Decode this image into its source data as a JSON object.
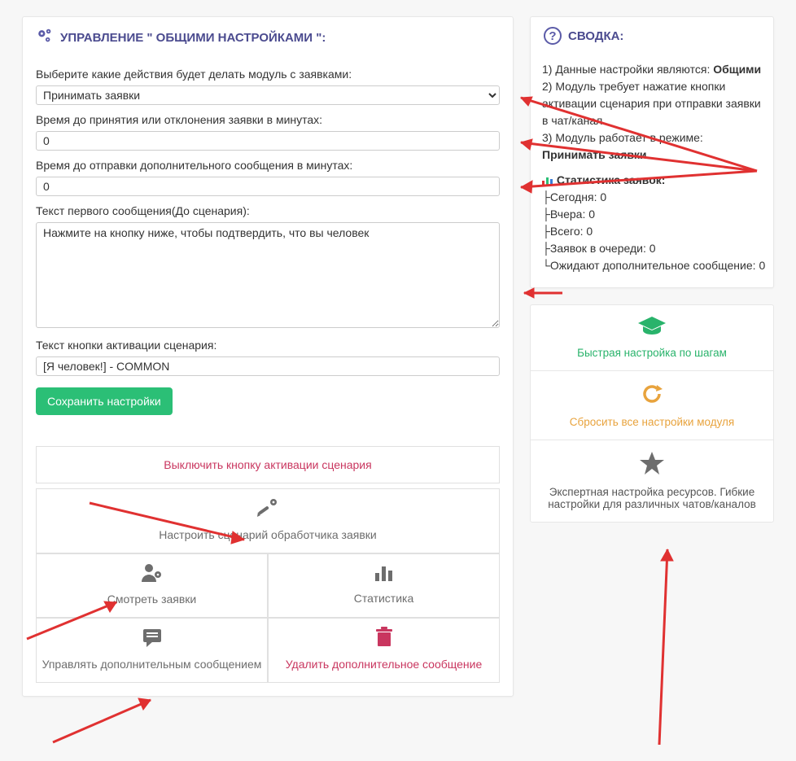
{
  "main": {
    "title": "УПРАВЛЕНИЕ \" ОБЩИМИ НАСТРОЙКАМИ \":",
    "action_label": "Выберите какие действия будет делать модуль с заявками:",
    "action_selected": "Принимать заявки",
    "time_accept_label": "Время до принятия или отклонения заявки в минутах:",
    "time_accept_value": "0",
    "time_extra_label": "Время до отправки дополнительного сообщения в минутах:",
    "time_extra_value": "0",
    "first_msg_label": "Текст первого сообщения(До сценария):",
    "first_msg_value": "Нажмите на кнопку ниже, чтобы подтвердить, что вы человек",
    "button_text_label": "Текст кнопки активации сценария:",
    "button_text_value": "[Я человек!] - COMMON",
    "save_btn": "Сохранить настройки",
    "disable_btn": "Выключить кнопку активации сценария",
    "tiles": {
      "config_scenario": "Настроить сценарий обработчика заявки",
      "view_requests": "Смотреть заявки",
      "statistics": "Статистика",
      "manage_extra": "Управлять дополнительным сообщением",
      "delete_extra": "Удалить дополнительное сообщение"
    }
  },
  "summary": {
    "title": "СВОДКА:",
    "line1_prefix": "1) Данные настройки являются: ",
    "line1_bold": "Общими",
    "line2": "2) Модуль требует нажатие кнопки активации сценария при отправки заявки в чат/канал",
    "line3_prefix": "3) Модуль работает в режиме: ",
    "line3_bold": "Принимать заявки",
    "stats_title": "Статистика заявок:",
    "stats": {
      "today_label": "Сегодня: ",
      "today_val": "0",
      "yesterday_label": "Вчера: ",
      "yesterday_val": "0",
      "total_label": "Всего: ",
      "total_val": "0",
      "queue_label": "Заявок в очереди: ",
      "queue_val": "0",
      "await_label": "Ожидают дополнительное сообщение: ",
      "await_val": "0"
    },
    "cards": {
      "quick": "Быстрая настройка по шагам",
      "reset": "Сбросить все настройки модуля",
      "expert": "Экспертная настройка ресурсов. Гибкие настройки для различных чатов/каналов"
    }
  }
}
